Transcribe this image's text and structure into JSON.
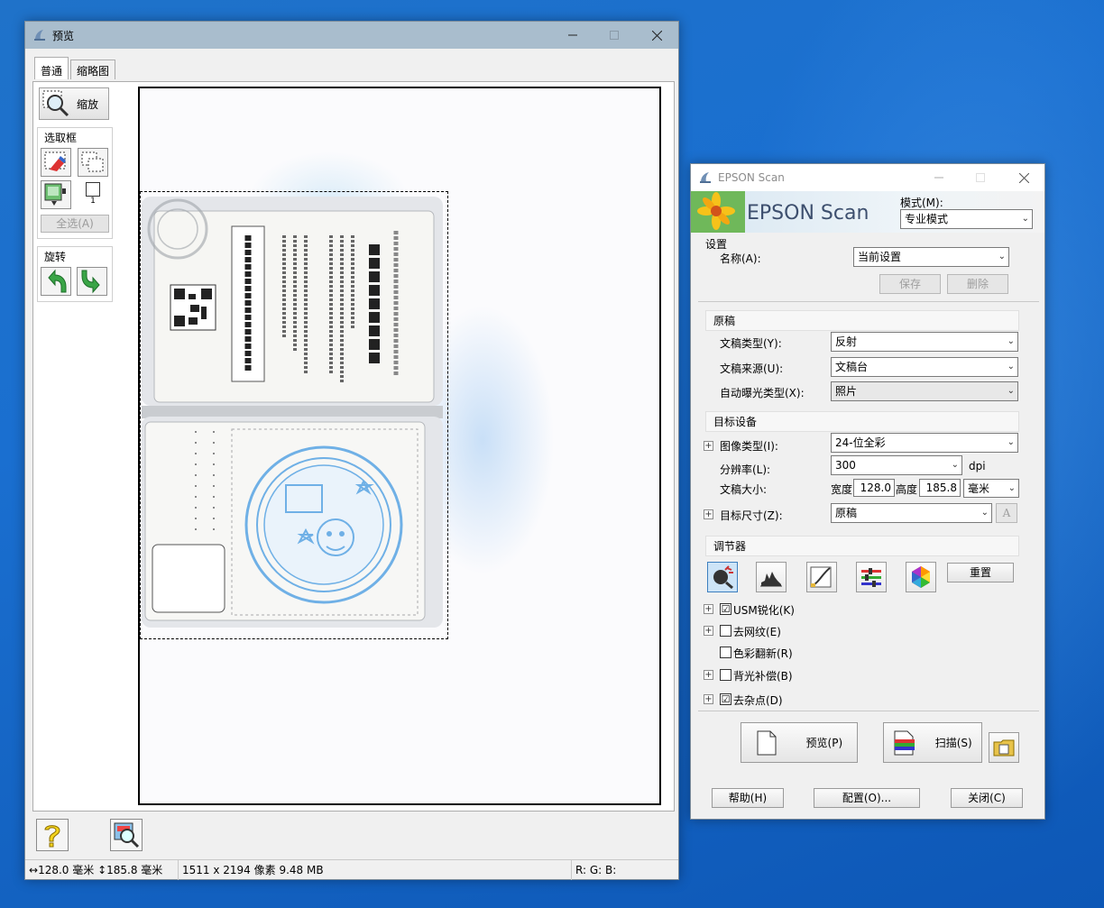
{
  "preview_window": {
    "title": "预览",
    "tabs": [
      "普通",
      "缩略图"
    ],
    "zoom_label": "缩放",
    "marquee_group_title": "选取框",
    "marquee_count": "1",
    "select_all_label": "全选(A)",
    "rotate_group_title": "旋转",
    "status": {
      "width": "128.0 毫米",
      "height": "185.8 毫米",
      "pixels": "1511 x 2194 像素 9.48 MB",
      "rgb": "R: G: B:"
    }
  },
  "epson_window": {
    "title": "EPSON Scan",
    "banner_title": "EPSON Scan",
    "mode_label": "模式(M):",
    "mode_value": "专业模式",
    "settings": {
      "title": "设置",
      "name_label": "名称(A):",
      "name_value": "当前设置",
      "save_label": "保存",
      "delete_label": "删除"
    },
    "original": {
      "title": "原稿",
      "doc_type_label": "文稿类型(Y):",
      "doc_type_value": "反射",
      "doc_source_label": "文稿来源(U):",
      "doc_source_value": "文稿台",
      "exposure_label": "自动曝光类型(X):",
      "exposure_value": "照片"
    },
    "target": {
      "title": "目标设备",
      "image_type_label": "图像类型(I):",
      "image_type_value": "24-位全彩",
      "resolution_label": "分辨率(L):",
      "resolution_value": "300",
      "resolution_unit": "dpi",
      "doc_size_label": "文稿大小:",
      "width_label": "宽度",
      "width_value": "128.0",
      "height_label": "高度",
      "height_value": "185.8",
      "unit_value": "毫米",
      "target_size_label": "目标尺寸(Z):",
      "target_size_value": "原稿",
      "target_size_btn": "A"
    },
    "adjust": {
      "title": "调节器",
      "reset_label": "重置",
      "options": [
        {
          "label": "USM锐化(K)",
          "checked": "☑"
        },
        {
          "label": "去网纹(E)",
          "checked": ""
        },
        {
          "label": "色彩翻新(R)",
          "checked": ""
        },
        {
          "label": "背光补偿(B)",
          "checked": ""
        },
        {
          "label": "去杂点(D)",
          "checked": "☑"
        }
      ]
    },
    "preview_btn": "预览(P)",
    "scan_btn": "扫描(S)",
    "help_btn": "帮助(H)",
    "config_btn": "配置(O)...",
    "close_btn": "关闭(C)"
  },
  "colors": {
    "desktop": "#1a6fd0",
    "stamp_blue": "#6fb0e6",
    "preview_titlebar": "#a9bdcd"
  }
}
